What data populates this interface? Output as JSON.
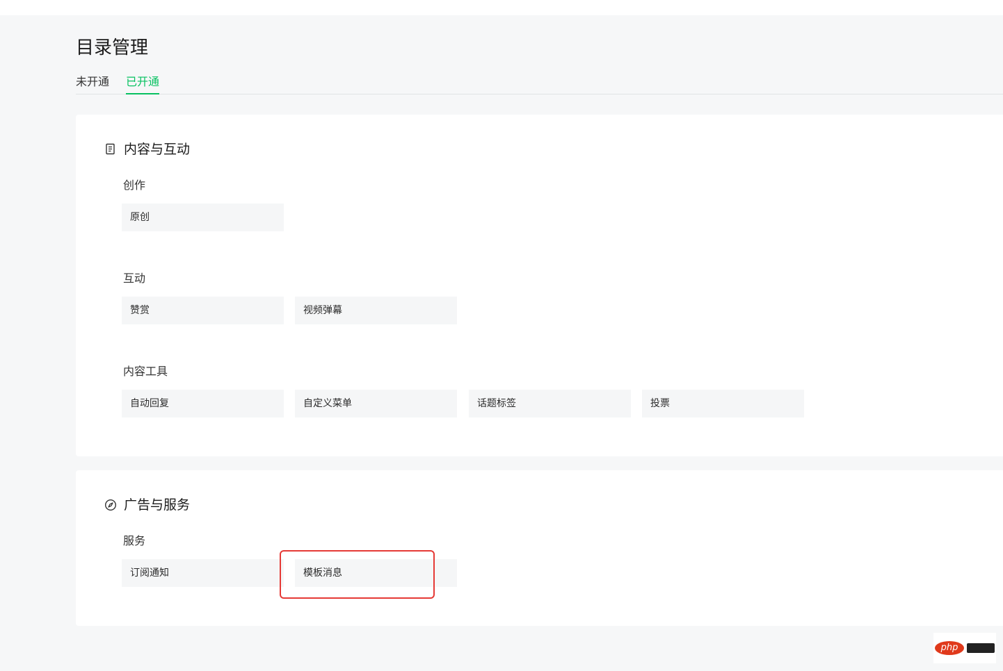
{
  "page": {
    "title": "目录管理"
  },
  "tabs": [
    {
      "label": "未开通",
      "active": false
    },
    {
      "label": "已开通",
      "active": true
    }
  ],
  "colors": {
    "accent": "#07c160",
    "highlight": "#e53935",
    "tile_bg": "#f5f6f7"
  },
  "sections": [
    {
      "icon": "document-icon",
      "title": "内容与互动",
      "groups": [
        {
          "label": "创作",
          "items": [
            "原创"
          ]
        },
        {
          "label": "互动",
          "items": [
            "赞赏",
            "视频弹幕"
          ]
        },
        {
          "label": "内容工具",
          "items": [
            "自动回复",
            "自定义菜单",
            "话题标签",
            "投票"
          ]
        }
      ]
    },
    {
      "icon": "compass-icon",
      "title": "广告与服务",
      "groups": [
        {
          "label": "服务",
          "items": [
            "订阅通知",
            "模板消息"
          ]
        }
      ]
    }
  ],
  "watermark": {
    "logo": "php"
  }
}
